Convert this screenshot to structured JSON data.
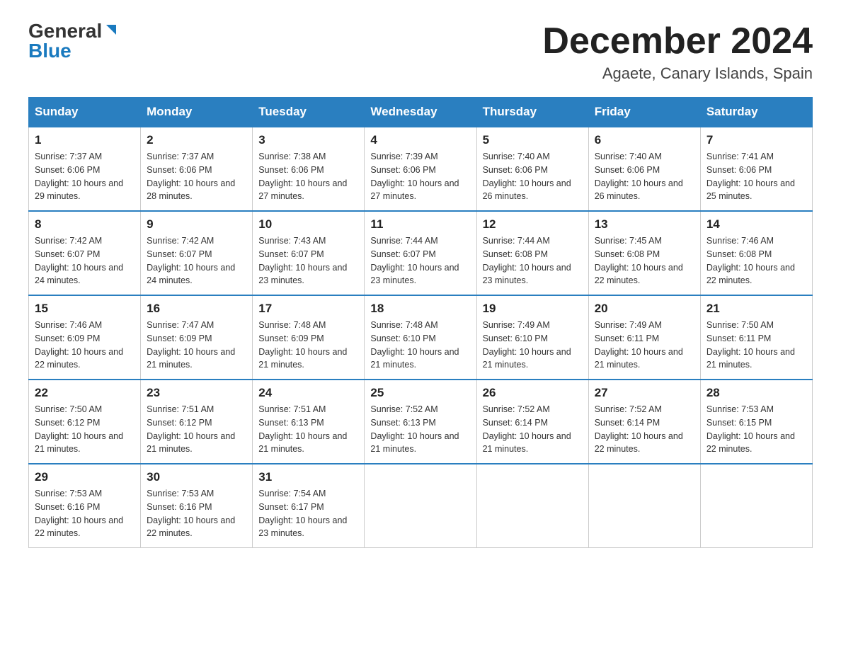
{
  "header": {
    "logo_general": "General",
    "logo_blue": "Blue",
    "month_title": "December 2024",
    "subtitle": "Agaete, Canary Islands, Spain"
  },
  "days_of_week": [
    "Sunday",
    "Monday",
    "Tuesday",
    "Wednesday",
    "Thursday",
    "Friday",
    "Saturday"
  ],
  "weeks": [
    [
      {
        "num": "1",
        "sunrise": "7:37 AM",
        "sunset": "6:06 PM",
        "daylight": "10 hours and 29 minutes."
      },
      {
        "num": "2",
        "sunrise": "7:37 AM",
        "sunset": "6:06 PM",
        "daylight": "10 hours and 28 minutes."
      },
      {
        "num": "3",
        "sunrise": "7:38 AM",
        "sunset": "6:06 PM",
        "daylight": "10 hours and 27 minutes."
      },
      {
        "num": "4",
        "sunrise": "7:39 AM",
        "sunset": "6:06 PM",
        "daylight": "10 hours and 27 minutes."
      },
      {
        "num": "5",
        "sunrise": "7:40 AM",
        "sunset": "6:06 PM",
        "daylight": "10 hours and 26 minutes."
      },
      {
        "num": "6",
        "sunrise": "7:40 AM",
        "sunset": "6:06 PM",
        "daylight": "10 hours and 26 minutes."
      },
      {
        "num": "7",
        "sunrise": "7:41 AM",
        "sunset": "6:06 PM",
        "daylight": "10 hours and 25 minutes."
      }
    ],
    [
      {
        "num": "8",
        "sunrise": "7:42 AM",
        "sunset": "6:07 PM",
        "daylight": "10 hours and 24 minutes."
      },
      {
        "num": "9",
        "sunrise": "7:42 AM",
        "sunset": "6:07 PM",
        "daylight": "10 hours and 24 minutes."
      },
      {
        "num": "10",
        "sunrise": "7:43 AM",
        "sunset": "6:07 PM",
        "daylight": "10 hours and 23 minutes."
      },
      {
        "num": "11",
        "sunrise": "7:44 AM",
        "sunset": "6:07 PM",
        "daylight": "10 hours and 23 minutes."
      },
      {
        "num": "12",
        "sunrise": "7:44 AM",
        "sunset": "6:08 PM",
        "daylight": "10 hours and 23 minutes."
      },
      {
        "num": "13",
        "sunrise": "7:45 AM",
        "sunset": "6:08 PM",
        "daylight": "10 hours and 22 minutes."
      },
      {
        "num": "14",
        "sunrise": "7:46 AM",
        "sunset": "6:08 PM",
        "daylight": "10 hours and 22 minutes."
      }
    ],
    [
      {
        "num": "15",
        "sunrise": "7:46 AM",
        "sunset": "6:09 PM",
        "daylight": "10 hours and 22 minutes."
      },
      {
        "num": "16",
        "sunrise": "7:47 AM",
        "sunset": "6:09 PM",
        "daylight": "10 hours and 21 minutes."
      },
      {
        "num": "17",
        "sunrise": "7:48 AM",
        "sunset": "6:09 PM",
        "daylight": "10 hours and 21 minutes."
      },
      {
        "num": "18",
        "sunrise": "7:48 AM",
        "sunset": "6:10 PM",
        "daylight": "10 hours and 21 minutes."
      },
      {
        "num": "19",
        "sunrise": "7:49 AM",
        "sunset": "6:10 PM",
        "daylight": "10 hours and 21 minutes."
      },
      {
        "num": "20",
        "sunrise": "7:49 AM",
        "sunset": "6:11 PM",
        "daylight": "10 hours and 21 minutes."
      },
      {
        "num": "21",
        "sunrise": "7:50 AM",
        "sunset": "6:11 PM",
        "daylight": "10 hours and 21 minutes."
      }
    ],
    [
      {
        "num": "22",
        "sunrise": "7:50 AM",
        "sunset": "6:12 PM",
        "daylight": "10 hours and 21 minutes."
      },
      {
        "num": "23",
        "sunrise": "7:51 AM",
        "sunset": "6:12 PM",
        "daylight": "10 hours and 21 minutes."
      },
      {
        "num": "24",
        "sunrise": "7:51 AM",
        "sunset": "6:13 PM",
        "daylight": "10 hours and 21 minutes."
      },
      {
        "num": "25",
        "sunrise": "7:52 AM",
        "sunset": "6:13 PM",
        "daylight": "10 hours and 21 minutes."
      },
      {
        "num": "26",
        "sunrise": "7:52 AM",
        "sunset": "6:14 PM",
        "daylight": "10 hours and 21 minutes."
      },
      {
        "num": "27",
        "sunrise": "7:52 AM",
        "sunset": "6:14 PM",
        "daylight": "10 hours and 22 minutes."
      },
      {
        "num": "28",
        "sunrise": "7:53 AM",
        "sunset": "6:15 PM",
        "daylight": "10 hours and 22 minutes."
      }
    ],
    [
      {
        "num": "29",
        "sunrise": "7:53 AM",
        "sunset": "6:16 PM",
        "daylight": "10 hours and 22 minutes."
      },
      {
        "num": "30",
        "sunrise": "7:53 AM",
        "sunset": "6:16 PM",
        "daylight": "10 hours and 22 minutes."
      },
      {
        "num": "31",
        "sunrise": "7:54 AM",
        "sunset": "6:17 PM",
        "daylight": "10 hours and 23 minutes."
      },
      null,
      null,
      null,
      null
    ]
  ]
}
